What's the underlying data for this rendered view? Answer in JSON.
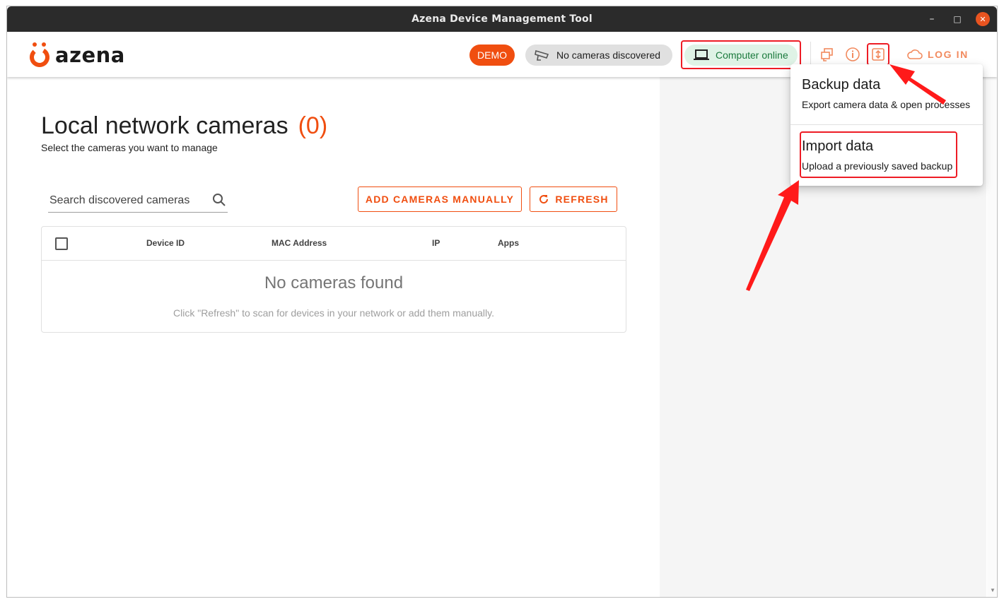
{
  "window": {
    "title": "Azena Device Management Tool"
  },
  "brand": {
    "logo_text": "azena",
    "accent": "#f04e10"
  },
  "appbar": {
    "demo_label": "DEMO",
    "cameras_status": "No cameras discovered",
    "computer_status": "Computer online",
    "login_label": "LOG IN",
    "icons": [
      "cameras-icon",
      "info-icon",
      "backup-import-icon",
      "cloud-icon"
    ]
  },
  "main": {
    "title": "Local network cameras",
    "count": "(0)",
    "subtitle": "Select the cameras you want to manage",
    "search_placeholder": "Search discovered cameras",
    "add_button": "ADD CAMERAS MANUALLY",
    "refresh_button": "REFRESH"
  },
  "table": {
    "columns": [
      "Device ID",
      "MAC Address",
      "IP",
      "Apps"
    ],
    "empty_title": "No cameras found",
    "empty_subtitle": "Click \"Refresh\" to scan for devices in your network or add them manually."
  },
  "menu": {
    "items": [
      {
        "title": "Backup data",
        "subtitle": "Export camera data & open processes"
      },
      {
        "title": "Import data",
        "subtitle": "Upload a previously saved backup"
      }
    ]
  },
  "annotation": {
    "highlight_color": "#ee1c25"
  }
}
